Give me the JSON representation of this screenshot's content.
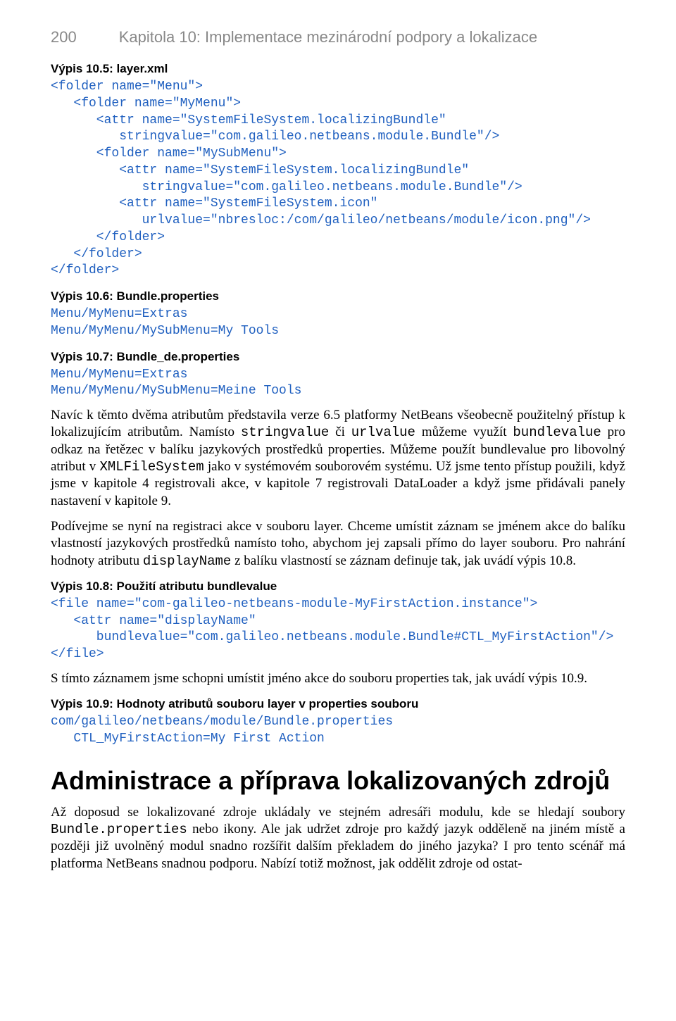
{
  "header": {
    "pagenum": "200",
    "title": "Kapitola 10: Implementace mezinárodní podpory a lokalizace"
  },
  "listing105": {
    "label": "Výpis 10.5: layer.xml",
    "code": "<folder name=\"Menu\">\n   <folder name=\"MyMenu\">\n      <attr name=\"SystemFileSystem.localizingBundle\"\n         stringvalue=\"com.galileo.netbeans.module.Bundle\"/>\n      <folder name=\"MySubMenu\">\n         <attr name=\"SystemFileSystem.localizingBundle\"\n            stringvalue=\"com.galileo.netbeans.module.Bundle\"/>\n         <attr name=\"SystemFileSystem.icon\"\n            urlvalue=\"nbresloc:/com/galileo/netbeans/module/icon.png\"/>\n      </folder>\n   </folder>\n</folder>"
  },
  "listing106": {
    "label": "Výpis 10.6: Bundle.properties",
    "code": "Menu/MyMenu=Extras\nMenu/MyMenu/MySubMenu=My Tools"
  },
  "listing107": {
    "label": "Výpis 10.7: Bundle_de.properties",
    "code": "Menu/MyMenu=Extras\nMenu/MyMenu/MySubMenu=Meine Tools"
  },
  "para1": {
    "t1": "Navíc k těmto dvěma atributům představila verze 6.5 platformy NetBeans všeobecně použitelný přístup k lokalizujícím atributům. Namísto ",
    "m1": "stringvalue",
    "t2": " či ",
    "m2": "urlvalue",
    "t3": " můžeme využít ",
    "m3": "bundlevalue",
    "t4": " pro odkaz na řetězec v balíku jazykových prostředků properties. Můžeme použít bundlevalue pro libovolný atribut v ",
    "m4": "XMLFileSystem",
    "t5": " jako v systémovém souborovém systému. Už jsme tento přístup použili, když jsme v kapitole 4 registrovali akce, v kapitole 7 registrovali DataLoader a když jsme přidávali panely nastavení v kapitole 9."
  },
  "para2": {
    "t1": "Podívejme se nyní na registraci akce v souboru layer. Chceme umístit záznam se jménem akce do balíku vlastností jazykových prostředků namísto toho, abychom jej zapsali přímo do layer souboru. Pro nahrání hodnoty atributu ",
    "m1": "displayName",
    "t2": " z balíku vlastností se záznam definuje tak, jak uvádí výpis 10.8."
  },
  "listing108": {
    "label": "Výpis 10.8: Použití atributu bundlevalue",
    "code": "<file name=\"com-galileo-netbeans-module-MyFirstAction.instance\">\n   <attr name=\"displayName\"\n      bundlevalue=\"com.galileo.netbeans.module.Bundle#CTL_MyFirstAction\"/>\n</file>"
  },
  "para3": "S tímto záznamem jsme schopni umístit jméno akce do souboru properties tak, jak uvádí výpis 10.9.",
  "listing109": {
    "label": "Výpis 10.9: Hodnoty atributů souboru layer v properties souboru",
    "code": "com/galileo/netbeans/module/Bundle.properties\n   CTL_MyFirstAction=My First Action"
  },
  "section_heading": "Administrace a příprava lokalizovaných zdrojů",
  "para4": {
    "t1": "Až doposud se lokalizované zdroje ukládaly ve stejném adresáři modulu, kde se hledají soubory ",
    "m1": "Bundle.properties",
    "t2": " nebo ikony. Ale jak udržet zdroje pro každý jazyk odděleně na jiném místě a později již uvolněný modul snadno rozšířit dalším překladem do jiného jazyka? I pro tento scénář má platforma NetBeans snadnou podporu. Nabízí totiž možnost, jak oddělit zdroje od ostat-"
  }
}
